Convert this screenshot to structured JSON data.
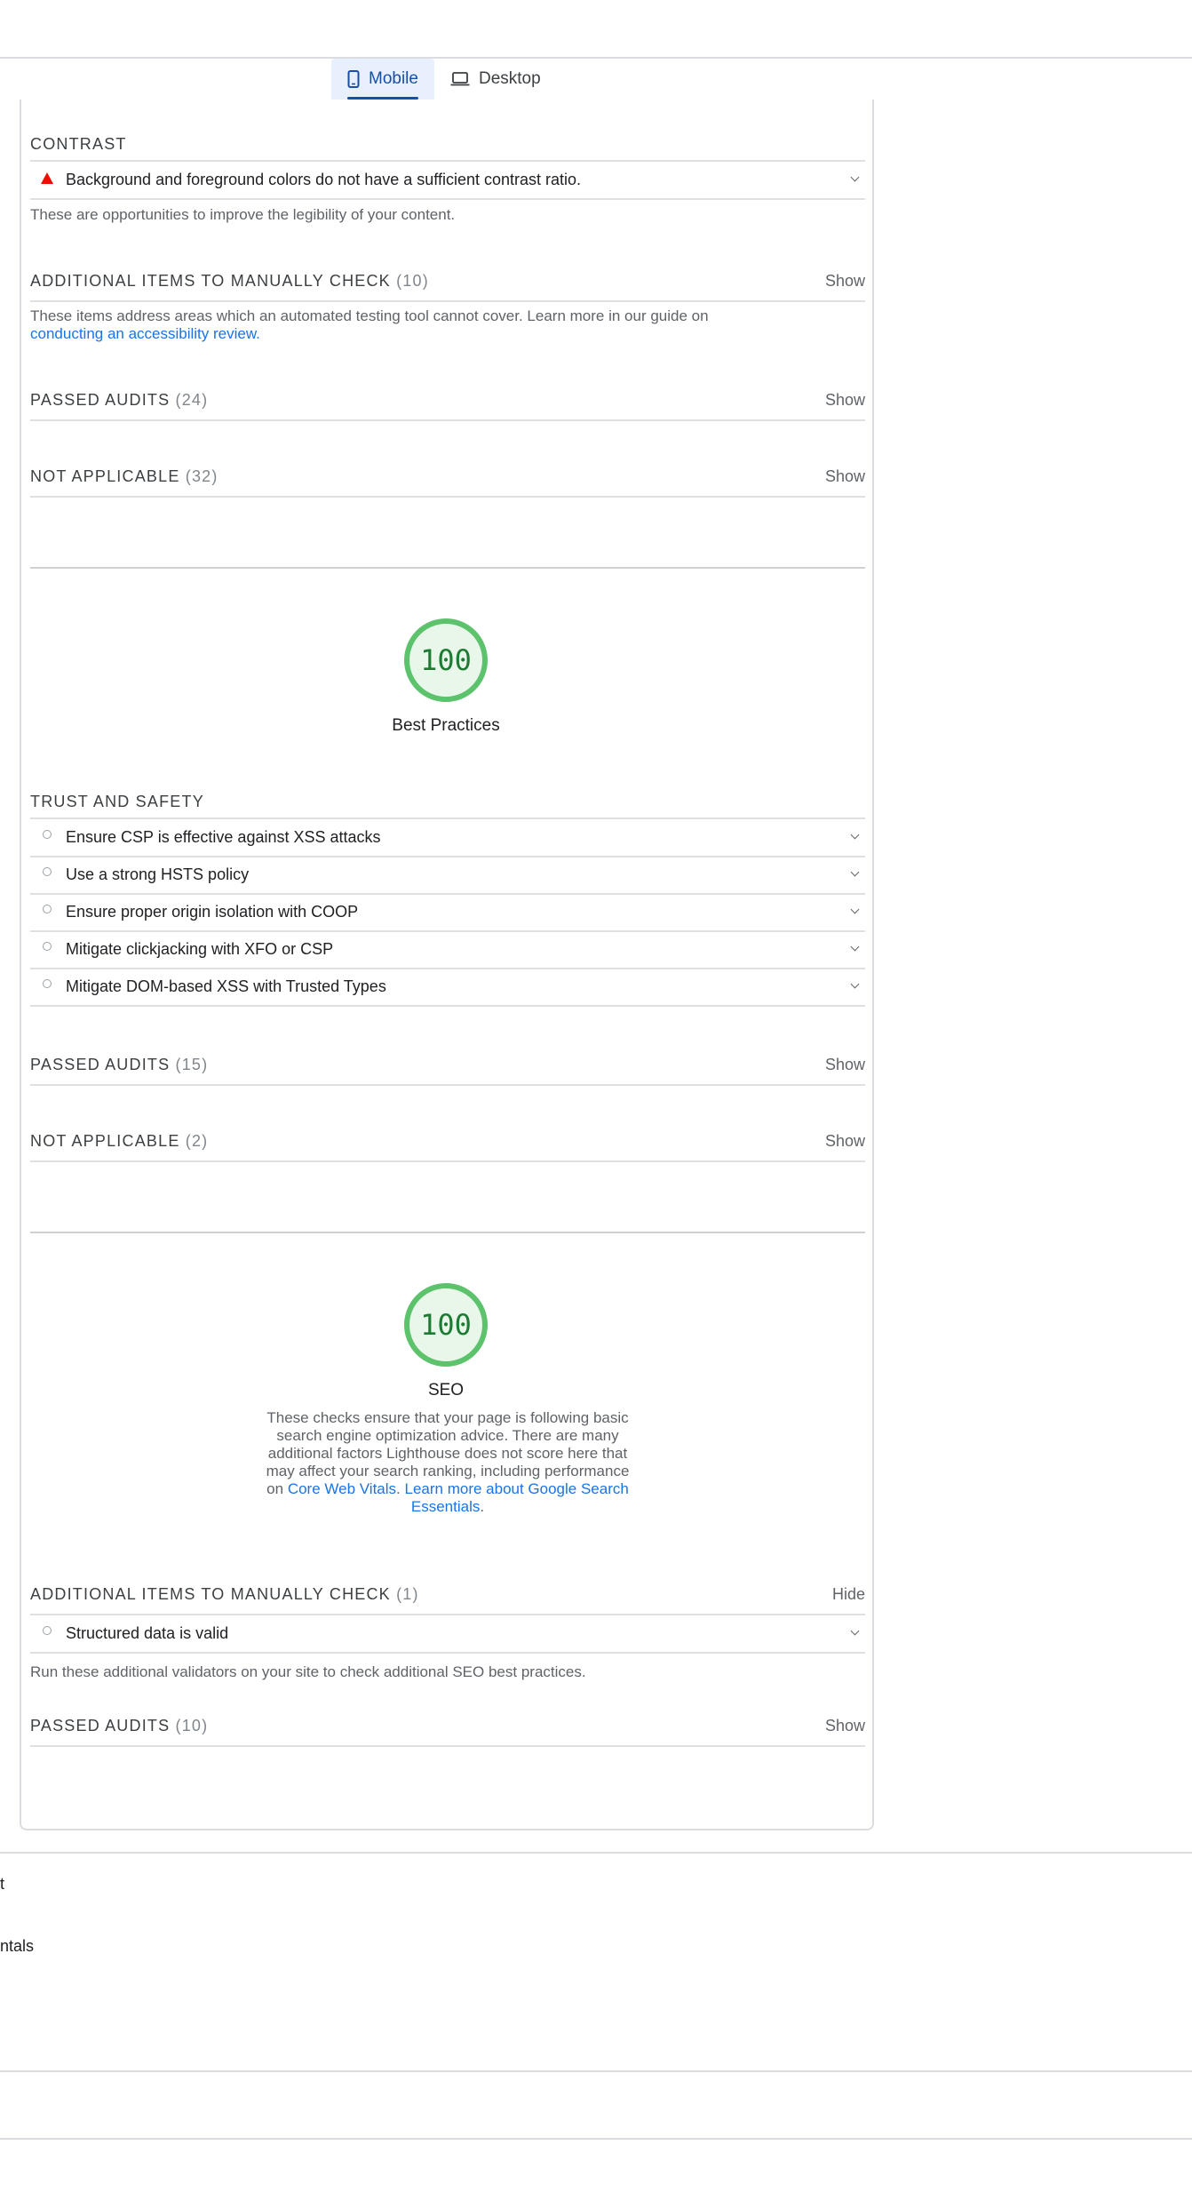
{
  "tabs": [
    {
      "label": "Mobile",
      "icon": "phone-icon",
      "active": true
    },
    {
      "label": "Desktop",
      "icon": "laptop-icon",
      "active": false
    }
  ],
  "accessibility": {
    "contrast_title": "CONTRAST",
    "contrast_audit": "Background and foreground colors do not have a sufficient contrast ratio.",
    "contrast_desc": "These are opportunities to improve the legibility of your content.",
    "manual": {
      "title": "ADDITIONAL ITEMS TO MANUALLY CHECK",
      "count": "(10)",
      "toggle": "Show",
      "desc": "These items address areas which an automated testing tool cannot cover. Learn more in our guide on",
      "link": "conducting an accessibility review."
    },
    "passed": {
      "title": "PASSED AUDITS",
      "count": "(24)",
      "toggle": "Show"
    },
    "na": {
      "title": "NOT APPLICABLE",
      "count": "(32)",
      "toggle": "Show"
    }
  },
  "best_practices": {
    "score": "100",
    "label": "Best Practices",
    "group_title": "TRUST AND SAFETY",
    "audits": [
      "Ensure CSP is effective against XSS attacks",
      "Use a strong HSTS policy",
      "Ensure proper origin isolation with COOP",
      "Mitigate clickjacking with XFO or CSP",
      "Mitigate DOM-based XSS with Trusted Types"
    ],
    "passed": {
      "title": "PASSED AUDITS",
      "count": "(15)",
      "toggle": "Show"
    },
    "na": {
      "title": "NOT APPLICABLE",
      "count": "(2)",
      "toggle": "Show"
    }
  },
  "seo": {
    "score": "100",
    "label": "SEO",
    "desc": "These checks ensure that your page is following basic search engine optimization advice. There are many additional factors Lighthouse does not score here that may affect your search ranking, including performance on",
    "link1": "Core Web Vitals",
    "link2": "Learn more about Google Search Essentials",
    "manual": {
      "title": "ADDITIONAL ITEMS TO MANUALLY CHECK",
      "count": "(1)",
      "toggle": "Hide"
    },
    "manual_audit": "Structured data is valid",
    "manual_desc": "Run these additional validators on your site to check additional SEO best practices.",
    "passed": {
      "title": "PASSED AUDITS",
      "count": "(10)",
      "toggle": "Show"
    }
  },
  "footer": {
    "link1": "t",
    "link2": "ntals"
  },
  "colors": {
    "pass": "#5cc26c",
    "fail": "#eb0f00",
    "link": "#1a73e8",
    "active_tab": "#174ea6"
  }
}
